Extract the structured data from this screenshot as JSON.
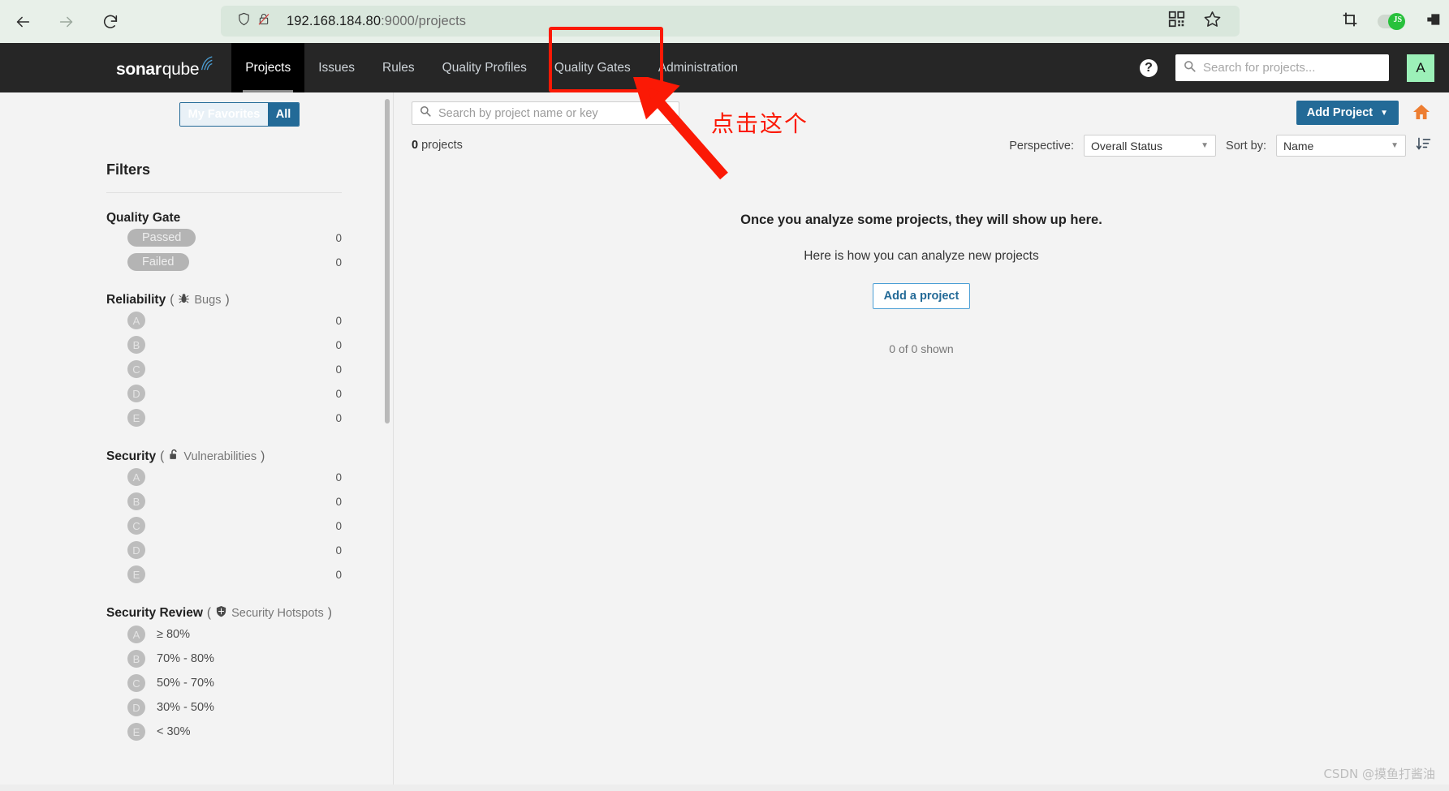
{
  "browser": {
    "back_icon": "arrow-left-icon",
    "forward_icon": "arrow-right-icon",
    "reload_icon": "reload-icon",
    "shield_icon": "shield-icon",
    "insecure_icon": "insecure-lock-icon",
    "url_host": "192.168.184.80",
    "url_path": ":9000/projects",
    "qr_icon": "qr-code-icon",
    "bookmark_icon": "star-icon",
    "screenshot_icon": "crop-icon",
    "js_toggle_label": "JS",
    "pocket_icon": "pocket-icon"
  },
  "navbar": {
    "logo_bold": "sonar",
    "logo_light": "qube",
    "items": [
      {
        "label": "Projects",
        "active": true
      },
      {
        "label": "Issues",
        "active": false
      },
      {
        "label": "Rules",
        "active": false
      },
      {
        "label": "Quality Profiles",
        "active": false
      },
      {
        "label": "Quality Gates",
        "active": false
      },
      {
        "label": "Administration",
        "active": false
      }
    ],
    "help_label": "?",
    "search_placeholder": "Search for projects...",
    "search_value": "",
    "avatar_letter": "A"
  },
  "sidebar": {
    "toggle": {
      "favorites": "My Favorites",
      "all": "All"
    },
    "filters_title": "Filters",
    "facets": [
      {
        "title": "Quality Gate",
        "type": "pill",
        "rows": [
          {
            "label": "Passed",
            "count": "0"
          },
          {
            "label": "Failed",
            "count": "0"
          }
        ]
      },
      {
        "title": "Reliability",
        "sub": "Bugs",
        "icon": "bug-icon",
        "type": "rating",
        "rows": [
          {
            "label": "A",
            "count": "0"
          },
          {
            "label": "B",
            "count": "0"
          },
          {
            "label": "C",
            "count": "0"
          },
          {
            "label": "D",
            "count": "0"
          },
          {
            "label": "E",
            "count": "0"
          }
        ]
      },
      {
        "title": "Security",
        "sub": "Vulnerabilities",
        "icon": "open-lock-icon",
        "type": "rating",
        "rows": [
          {
            "label": "A",
            "count": "0"
          },
          {
            "label": "B",
            "count": "0"
          },
          {
            "label": "C",
            "count": "0"
          },
          {
            "label": "D",
            "count": "0"
          },
          {
            "label": "E",
            "count": "0"
          }
        ]
      },
      {
        "title": "Security Review",
        "sub": "Security Hotspots",
        "icon": "shield-icon",
        "type": "rating-range",
        "rows": [
          {
            "label": "A",
            "range": "≥ 80%",
            "count": ""
          },
          {
            "label": "B",
            "range": "70% - 80%",
            "count": ""
          },
          {
            "label": "C",
            "range": "50% - 70%",
            "count": ""
          },
          {
            "label": "D",
            "range": "30% - 50%",
            "count": ""
          },
          {
            "label": "E",
            "range": "< 30%",
            "count": ""
          }
        ]
      }
    ]
  },
  "main": {
    "search_placeholder": "Search by project name or key",
    "search_value": "",
    "search_icon": "search-icon",
    "project_count_number": "0",
    "project_count_word": "projects",
    "add_project_label": "Add Project",
    "add_project_caret": "▼",
    "home_icon": "home-icon",
    "perspective_label": "Perspective:",
    "perspective_value": "Overall Status",
    "sort_label": "Sort by:",
    "sort_value": "Name",
    "sort_order_icon": "sort-descending-icon",
    "empty_title": "Once you analyze some projects, they will show up here.",
    "empty_subtitle": "Here is how you can analyze new projects",
    "empty_button": "Add a project",
    "shown_count": "0 of 0 shown"
  },
  "annotation": {
    "text": "点击这个",
    "color": "#fb1905",
    "box_target": "Administration",
    "arrow_icon": "arrow-pointer-icon"
  },
  "watermark": "CSDN @摸鱼打酱油",
  "colors": {
    "navbar_bg": "#262626",
    "accent_blue": "#236a97",
    "annotation_red": "#fb1905",
    "avatar_green": "#9cf0b8",
    "home_orange": "#ed7d31"
  }
}
